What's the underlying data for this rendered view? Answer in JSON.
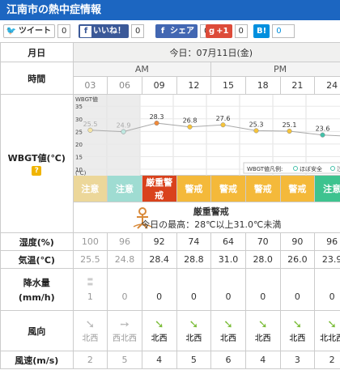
{
  "title": "江南市の熱中症情報",
  "social": {
    "tweet_label": "ツイート",
    "tweet_count": "0",
    "fb_label": "いいね！",
    "fb_count": "0",
    "share_label": "シェア",
    "share_count": "0",
    "gplus_label": "+1",
    "gplus_count": "0",
    "hatena_label": "B!",
    "hatena_count": "0"
  },
  "labels": {
    "date": "月日",
    "time": "時間",
    "wbgt": "WBGT値(℃)",
    "help": "?",
    "humidity": "湿度(%)",
    "temp": "気温(℃)",
    "rain_line1": "降水量",
    "rain_line2": "(mm/h)",
    "wind_dir": "風向",
    "wind_speed": "風速(m/s)"
  },
  "date_text": "今日：07月11日(金)",
  "am": "AM",
  "pm": "PM",
  "hours": [
    "03",
    "06",
    "09",
    "12",
    "15",
    "18",
    "21",
    "24"
  ],
  "chart_data": {
    "type": "line",
    "ylabel": "WBGT値",
    "yticks": [
      "35",
      "30",
      "25",
      "20",
      "15",
      "10"
    ],
    "yunit": "(℃)",
    "ylim": [
      10,
      37
    ],
    "x": [
      "03",
      "06",
      "09",
      "12",
      "15",
      "18",
      "21",
      "24"
    ],
    "values": [
      25.5,
      24.9,
      28.3,
      26.8,
      27.6,
      25.3,
      25.1,
      23.6
    ],
    "value_labels": [
      "25.5",
      "24.9",
      "28.3",
      "26.8",
      "27.6",
      "25.3",
      "25.1",
      "23.6"
    ],
    "point_colors": [
      "#f6e5a6",
      "#bfe8e1",
      "#f08a3a",
      "#f6c43b",
      "#f6c43b",
      "#f6c43b",
      "#f6c43b",
      "#44c1a9"
    ],
    "legend_title": "WBGT値凡例:",
    "legend_items": [
      "ほぼ安全",
      "注"
    ],
    "legend_colors": [
      "#44c1a9",
      "#44c1a9"
    ]
  },
  "warnings": [
    "注意",
    "注意",
    "厳重警戒",
    "警戒",
    "警戒",
    "警戒",
    "警戒",
    "注意"
  ],
  "warn_colors": [
    "#ecd79a",
    "#9fdcd2",
    "#d9421c",
    "#f4b93a",
    "#f4b93a",
    "#f4b93a",
    "#f4b93a",
    "#3ec38f"
  ],
  "summary": {
    "level": "厳重警戒",
    "today_text": "今日の最高：28℃以上31.0℃未満"
  },
  "humidity": [
    "100",
    "96",
    "92",
    "74",
    "64",
    "70",
    "90",
    "96"
  ],
  "temp": [
    "25.5",
    "24.8",
    "28.4",
    "28.8",
    "31.0",
    "28.0",
    "26.0",
    "23.9"
  ],
  "rain": [
    "1",
    "0",
    "0",
    "0",
    "0",
    "0",
    "0",
    "0"
  ],
  "wind_dir": [
    "北西",
    "西北西",
    "北西",
    "北西",
    "北西",
    "北西",
    "北西",
    "北北西"
  ],
  "wind_speed": [
    "2",
    "5",
    "4",
    "5",
    "6",
    "4",
    "3",
    "2"
  ],
  "colors": {
    "title_bg": "#1c66c1",
    "twitter": "#5ea9dd",
    "facebook": "#3b5998",
    "gplus": "#dd4b39",
    "hatena": "#008fde"
  }
}
